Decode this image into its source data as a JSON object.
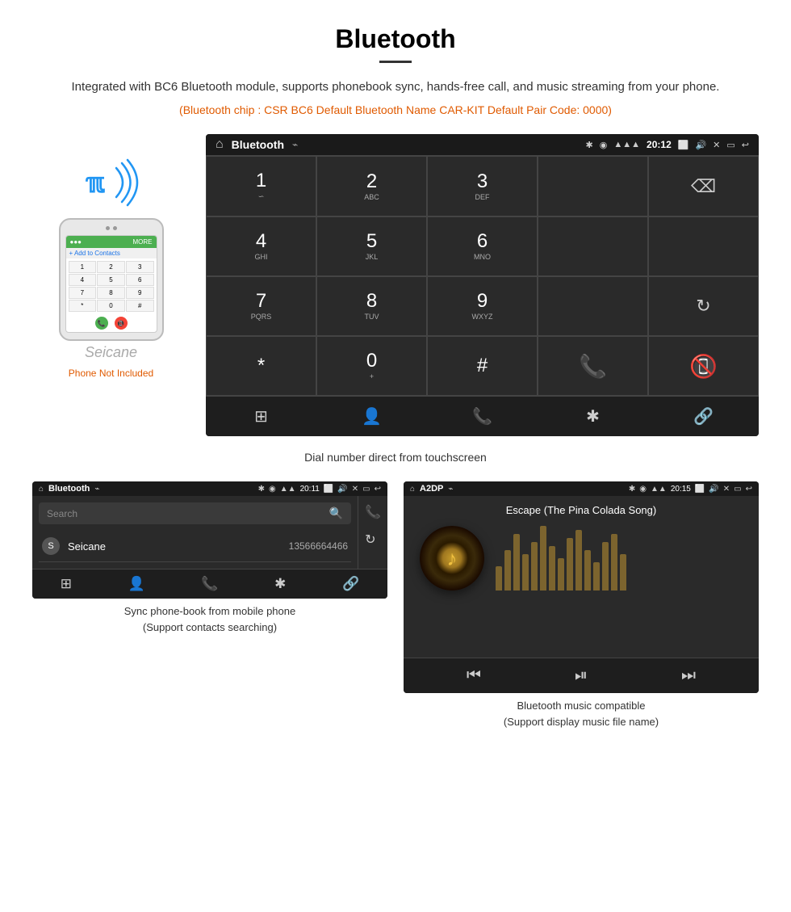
{
  "page": {
    "title": "Bluetooth",
    "description": "Integrated with BC6 Bluetooth module, supports phonebook sync, hands-free call, and music streaming from your phone.",
    "specs": "(Bluetooth chip : CSR BC6    Default Bluetooth Name CAR-KIT    Default Pair Code: 0000)",
    "main_caption": "Dial number direct from touchscreen",
    "bottom_left_caption": "Sync phone-book from mobile phone\n(Support contacts searching)",
    "bottom_right_caption": "Bluetooth music compatible\n(Support display music file name)",
    "phone_not_included": "Phone Not Included"
  },
  "main_screen": {
    "status_bar": {
      "title": "Bluetooth",
      "usb_icon": "⌁",
      "time": "20:12"
    },
    "dialpad": {
      "keys": [
        {
          "digit": "1",
          "sub": "∽"
        },
        {
          "digit": "2",
          "sub": "ABC"
        },
        {
          "digit": "3",
          "sub": "DEF"
        },
        {
          "digit": "4",
          "sub": "GHI"
        },
        {
          "digit": "5",
          "sub": "JKL"
        },
        {
          "digit": "6",
          "sub": "MNO"
        },
        {
          "digit": "7",
          "sub": "PQRS"
        },
        {
          "digit": "8",
          "sub": "TUV"
        },
        {
          "digit": "9",
          "sub": "WXYZ"
        },
        {
          "digit": "*",
          "sub": ""
        },
        {
          "digit": "0",
          "sub": "+"
        },
        {
          "digit": "#",
          "sub": ""
        }
      ]
    },
    "bottom_icons": [
      "⊞",
      "👤",
      "📞",
      "✱",
      "🔗"
    ]
  },
  "phonebook_screen": {
    "status_bar": {
      "title": "Bluetooth",
      "time": "20:11"
    },
    "search_placeholder": "Search",
    "contacts": [
      {
        "letter": "S",
        "name": "Seicane",
        "number": "13566664466"
      }
    ]
  },
  "music_screen": {
    "status_bar": {
      "title": "A2DP",
      "time": "20:15"
    },
    "song_title": "Escape (The Pina Colada Song)",
    "eq_bars": [
      30,
      50,
      70,
      45,
      60,
      80,
      55,
      40,
      65,
      75,
      50,
      35,
      60,
      70,
      45
    ]
  },
  "colors": {
    "accent": "#e05a00",
    "green_call": "#4CAF50",
    "red_call": "#f44336",
    "screen_bg": "#2a2a2a",
    "status_bg": "#1a1a1a"
  }
}
